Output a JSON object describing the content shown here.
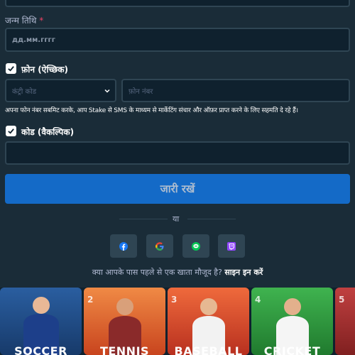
{
  "form": {
    "dob": {
      "label": "जन्म तिथि",
      "required_mark": "*",
      "placeholder": "дд.мм.гггг"
    },
    "phone": {
      "checkbox_label": "फ़ोन (ऐच्छिक)",
      "checked": true,
      "country_placeholder": "कंट्री कोड",
      "number_placeholder": "फ़ोन नंबर",
      "notice": "अपना फोन नंबर सबमिट करके, आप Stake से SMS के माध्यम से मार्केटिंग संचार और ऑफ़र प्राप्त करने के लिए सहमति दे रहे हैं।"
    },
    "code": {
      "checkbox_label": "कोड (वैकल्पिक)",
      "checked": true,
      "value": ""
    },
    "continue_label": "जारी रखें"
  },
  "divider": {
    "text": "या"
  },
  "social": [
    {
      "name": "facebook",
      "icon": "facebook-icon",
      "color": "#1877f2"
    },
    {
      "name": "google",
      "icon": "google-icon",
      "color": "#ea4335"
    },
    {
      "name": "line",
      "icon": "line-icon",
      "color": "#06c755"
    },
    {
      "name": "twitch",
      "icon": "twitch-icon",
      "color": "#9146ff"
    }
  ],
  "login": {
    "prompt": "क्या आपके पास पहले से एक खाता मौजूद है?",
    "link": "साइन इन करें"
  },
  "sports_banner": [
    {
      "number": "",
      "name": "SOCCER",
      "color": "#1f4e8c"
    },
    {
      "number": "2",
      "name": "TENNIS",
      "color": "#e0572b"
    },
    {
      "number": "3",
      "name": "BASEBALL",
      "color": "#d9462e"
    },
    {
      "number": "4",
      "name": "CRICKET",
      "color": "#2f9a3e"
    },
    {
      "number": "5",
      "name": "",
      "color": "#b03030"
    }
  ],
  "colors": {
    "background": "#1a2c38",
    "input_bg": "#0f212e",
    "border": "#2f4553",
    "primary_button": "#1475e1"
  }
}
